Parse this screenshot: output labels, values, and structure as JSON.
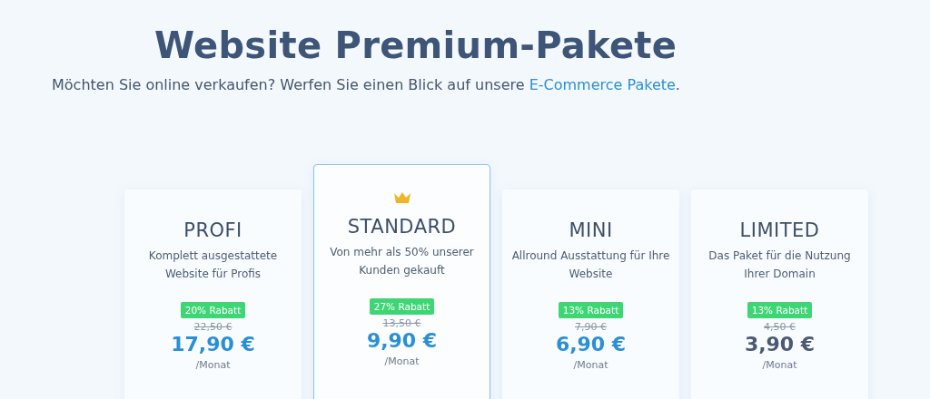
{
  "heading": "Website Premium-Pakete",
  "intro": {
    "text": "Möchten Sie online verkaufen? Werfen Sie einen Blick auf unsere",
    "link": "E-Commerce Pakete",
    "end": "."
  },
  "plans": [
    {
      "name": "PROFI",
      "description": "Komplett ausgestattete Website für Profis",
      "badge": "20% Rabatt",
      "old_price": "22,50 €",
      "price": "17,90 €",
      "period": "/Monat",
      "selected": false,
      "color": "#2a8fd4"
    },
    {
      "name": "STANDARD",
      "description": "Von mehr als 50% unserer Kunden gekauft",
      "badge": "27% Rabatt",
      "old_price": "13,50 €",
      "price": "9,90 €",
      "period": "/Monat",
      "selected": true,
      "color": "#2a8fd4"
    },
    {
      "name": "MINI",
      "description": "Allround Ausstattung für Ihre Website",
      "badge": "13% Rabatt",
      "old_price": "7,90 €",
      "price": "6,90 €",
      "period": "/Monat",
      "selected": false,
      "color": "#2a8fd4"
    },
    {
      "name": "LIMITED",
      "description": "Das Paket für die Nutzung Ihrer Domain",
      "badge": "13% Rabatt",
      "old_price": "4,50 €",
      "price": "3,90 €",
      "period": "/Monat",
      "selected": false,
      "color": "#4a5a70"
    }
  ]
}
